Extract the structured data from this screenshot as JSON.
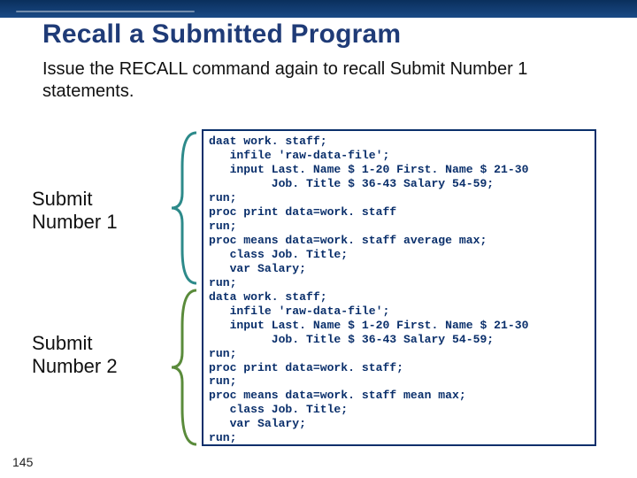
{
  "title": "Recall a Submitted Program",
  "body": "Issue the RECALL command again to recall Submit Number 1 statements.",
  "labels": {
    "submit1": "Submit\nNumber 1",
    "submit2": "Submit\nNumber 2"
  },
  "code": "daat work. staff;\n   infile 'raw-data-file';\n   input Last. Name $ 1-20 First. Name $ 21-30\n         Job. Title $ 36-43 Salary 54-59;\nrun;\nproc print data=work. staff\nrun;\nproc means data=work. staff average max;\n   class Job. Title;\n   var Salary;\nrun;\ndata work. staff;\n   infile 'raw-data-file';\n   input Last. Name $ 1-20 First. Name $ 21-30\n         Job. Title $ 36-43 Salary 54-59;\nrun;\nproc print data=work. staff;\nrun;\nproc means data=work. staff mean max;\n   class Job. Title;\n   var Salary;\nrun;",
  "page_number": "145",
  "brace_color1": "#2d8a8a",
  "brace_color2": "#5a8b3b"
}
